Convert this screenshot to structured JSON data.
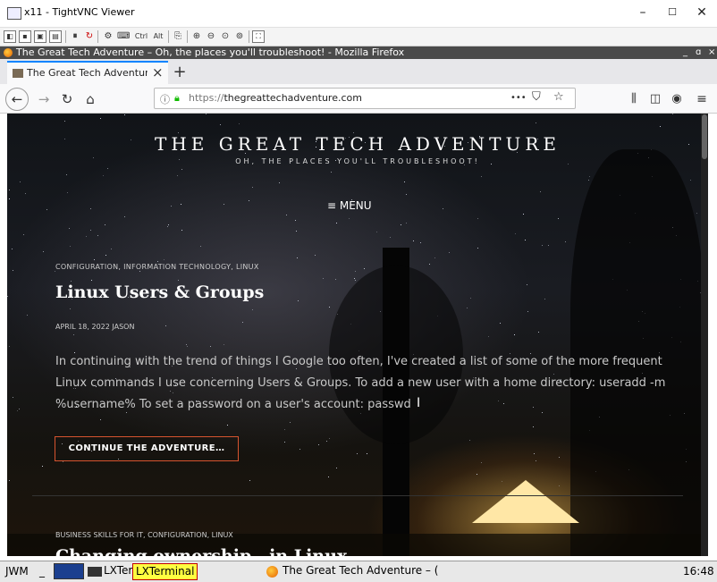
{
  "vnc": {
    "title": "x11 - TightVNC Viewer",
    "min": "–",
    "max": "☐",
    "close": "✕",
    "toolbar": {
      "ctrl": "Ctrl",
      "alt": "Alt"
    }
  },
  "firefox": {
    "window_title": "The Great Tech Adventure – Oh, the places you'll troubleshoot! - Mozilla Firefox",
    "tab_label": "The Great Tech Adventure",
    "tab_close": "×",
    "newtab": "+",
    "url_proto": "https://",
    "url_host": "thegreattechadventure.com",
    "url_more": "•••",
    "icons": [
      "back-icon",
      "forward-icon",
      "reload-icon",
      "home-icon",
      "info-icon",
      "lock-icon",
      "pocket-icon",
      "bookmark-star-icon",
      "library-icon",
      "sidebar-icon",
      "account-icon",
      "hamburger-menu-icon"
    ]
  },
  "site": {
    "title": "THE GREAT TECH ADVENTURE",
    "tagline": "OH, THE PLACES YOU'LL TROUBLESHOOT!",
    "menu": "≡ MENU",
    "post1": {
      "categories": "CONFIGURATION, INFORMATION TECHNOLOGY, LINUX",
      "title": "Linux Users & Groups",
      "meta": "APRIL 18, 2022   JASON",
      "excerpt": "In continuing with the trend of things I Google too often, I've created a list of some of the more frequent Linux commands I use concerning Users & Groups. To add a new user with a home directory: useradd -m %username% To set a password on a user's account: passwd",
      "button": "CONTINUE THE ADVENTURE…"
    },
    "post2": {
      "categories": "BUSINESS SKILLS FOR IT, CONFIGURATION, LINUX",
      "title": "Changing ownership...in Linux"
    }
  },
  "taskbar": {
    "wm": "JWM",
    "task1_label": "LXTer",
    "task1_highlight": "LXTerminal",
    "task2_label": "The Great Tech Adventure – (",
    "clock": "16:48"
  },
  "colors": {
    "accent": "#d7542f",
    "tab_accent": "#0a84ff",
    "lock": "#12bc00"
  }
}
